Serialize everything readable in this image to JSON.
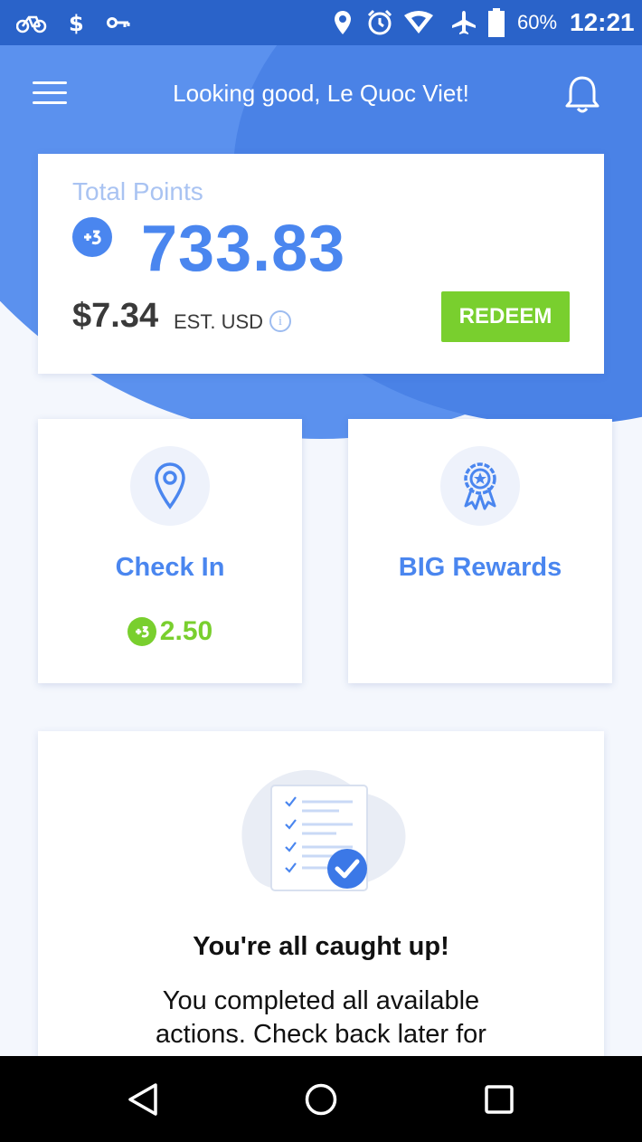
{
  "status_bar": {
    "battery": "60%",
    "time": "12:21",
    "icons": [
      "bike-icon",
      "dollar-icon",
      "key-icon",
      "location-icon",
      "alarm-icon",
      "wifi-icon",
      "airplane-icon",
      "battery-icon"
    ]
  },
  "header": {
    "greeting": "Looking good, Le Quoc Viet!",
    "menu_icon": "menu-icon",
    "notification_icon": "bell-icon"
  },
  "points_card": {
    "label": "Total Points",
    "value": "733.83",
    "usd_amount": "$7.34",
    "usd_label": "EST. USD",
    "info_symbol": "i",
    "redeem_label": "REDEEM"
  },
  "tiles": [
    {
      "title": "Check In",
      "icon": "location-pin-icon",
      "reward": "2.50"
    },
    {
      "title": "BIG Rewards",
      "icon": "award-ribbon-icon"
    }
  ],
  "caught_up": {
    "title": "You're all caught up!",
    "body": "You completed all available actions. Check back later for"
  },
  "colors": {
    "primary": "#4a86ef",
    "header": "#5b91ee",
    "status_bar": "#2a63c9",
    "green": "#79cf2e"
  }
}
